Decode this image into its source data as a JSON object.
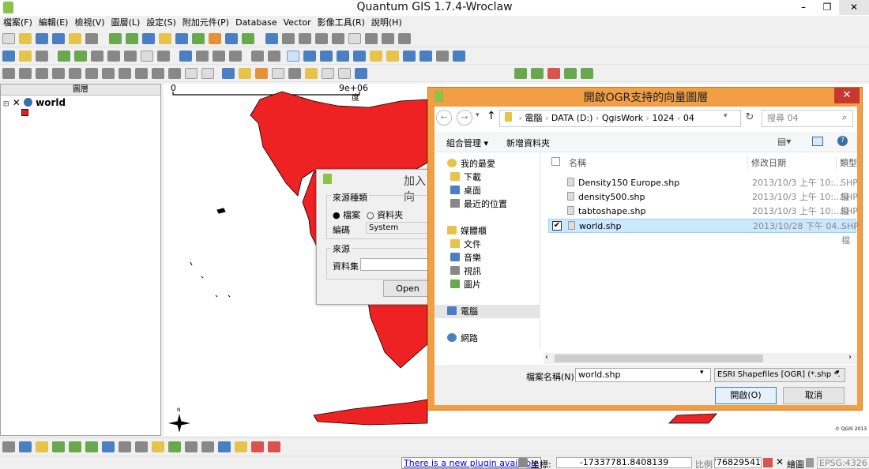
{
  "app": {
    "title": "Quantum GIS 1.7.4-Wroclaw",
    "min": "–",
    "max": "❐",
    "close": "✕"
  },
  "menu": [
    "檔案(F)",
    "編輯(E)",
    "檢視(V)",
    "圖層(L)",
    "設定(S)",
    "附加元件(P)",
    "Database",
    "Vector",
    "影像工具(R)",
    "說明(H)"
  ],
  "layers_panel": {
    "title": "圖層",
    "layer_name": "world",
    "color": "#e02020"
  },
  "map": {
    "scale_left": "0",
    "scale_right": "9e+06",
    "scale_unit": "度",
    "copyright": "© QGIS 2013",
    "land_color": "#ee2222"
  },
  "add_dialog": {
    "title": "加入向",
    "source_type": "來源種類",
    "opt_file": "檔案",
    "opt_folder": "資料夾",
    "encoding_label": "編碼",
    "encoding_value": "System",
    "source": "來源",
    "dataset_label": "資料集",
    "open_btn": "Open"
  },
  "open_dialog": {
    "title": "開啟OGR支持的向量圖層",
    "path": [
      "電腦",
      "DATA (D:)",
      "QgisWork",
      "1024",
      "04"
    ],
    "search_placeholder": "搜尋 04",
    "organize": "組合管理 ▾",
    "new_folder": "新增資料夾",
    "col_name": "名稱",
    "col_date": "修改日期",
    "col_type": "類型",
    "tree": {
      "favorites": "我的最愛",
      "downloads": "下載",
      "desktop": "桌面",
      "recent": "最近的位置",
      "libraries": "媒體櫃",
      "documents": "文件",
      "music": "音樂",
      "videos": "視訊",
      "pictures": "圖片",
      "computer": "電腦",
      "network": "網路"
    },
    "files": [
      {
        "name": "Density150 Europe.shp",
        "date": "2013/10/3 上午 10:...",
        "type": "SHP 檔"
      },
      {
        "name": "density500.shp",
        "date": "2013/10/3 上午 10:...",
        "type": "SHP 檔"
      },
      {
        "name": "tabtoshape.shp",
        "date": "2013/10/3 上午 10:...",
        "type": "SHP 檔"
      },
      {
        "name": "world.shp",
        "date": "2013/10/28 下午 04...",
        "type": "SHP 檔"
      }
    ],
    "filename_label": "檔案名稱(N):",
    "filename_value": "world.shp",
    "filter_value": "ESRI Shapefiles [OGR] (*.shp *.",
    "open_btn": "開啟(O)",
    "cancel_btn": "取消"
  },
  "status": {
    "plugin_link": "There is a new plugin available",
    "coord_label": "坐標:",
    "coord_value": "-17337781.8408139",
    "scale_label": "比例",
    "scale_value": "776829541",
    "render_label": "繪圖",
    "crs": "EPSG:4326"
  }
}
